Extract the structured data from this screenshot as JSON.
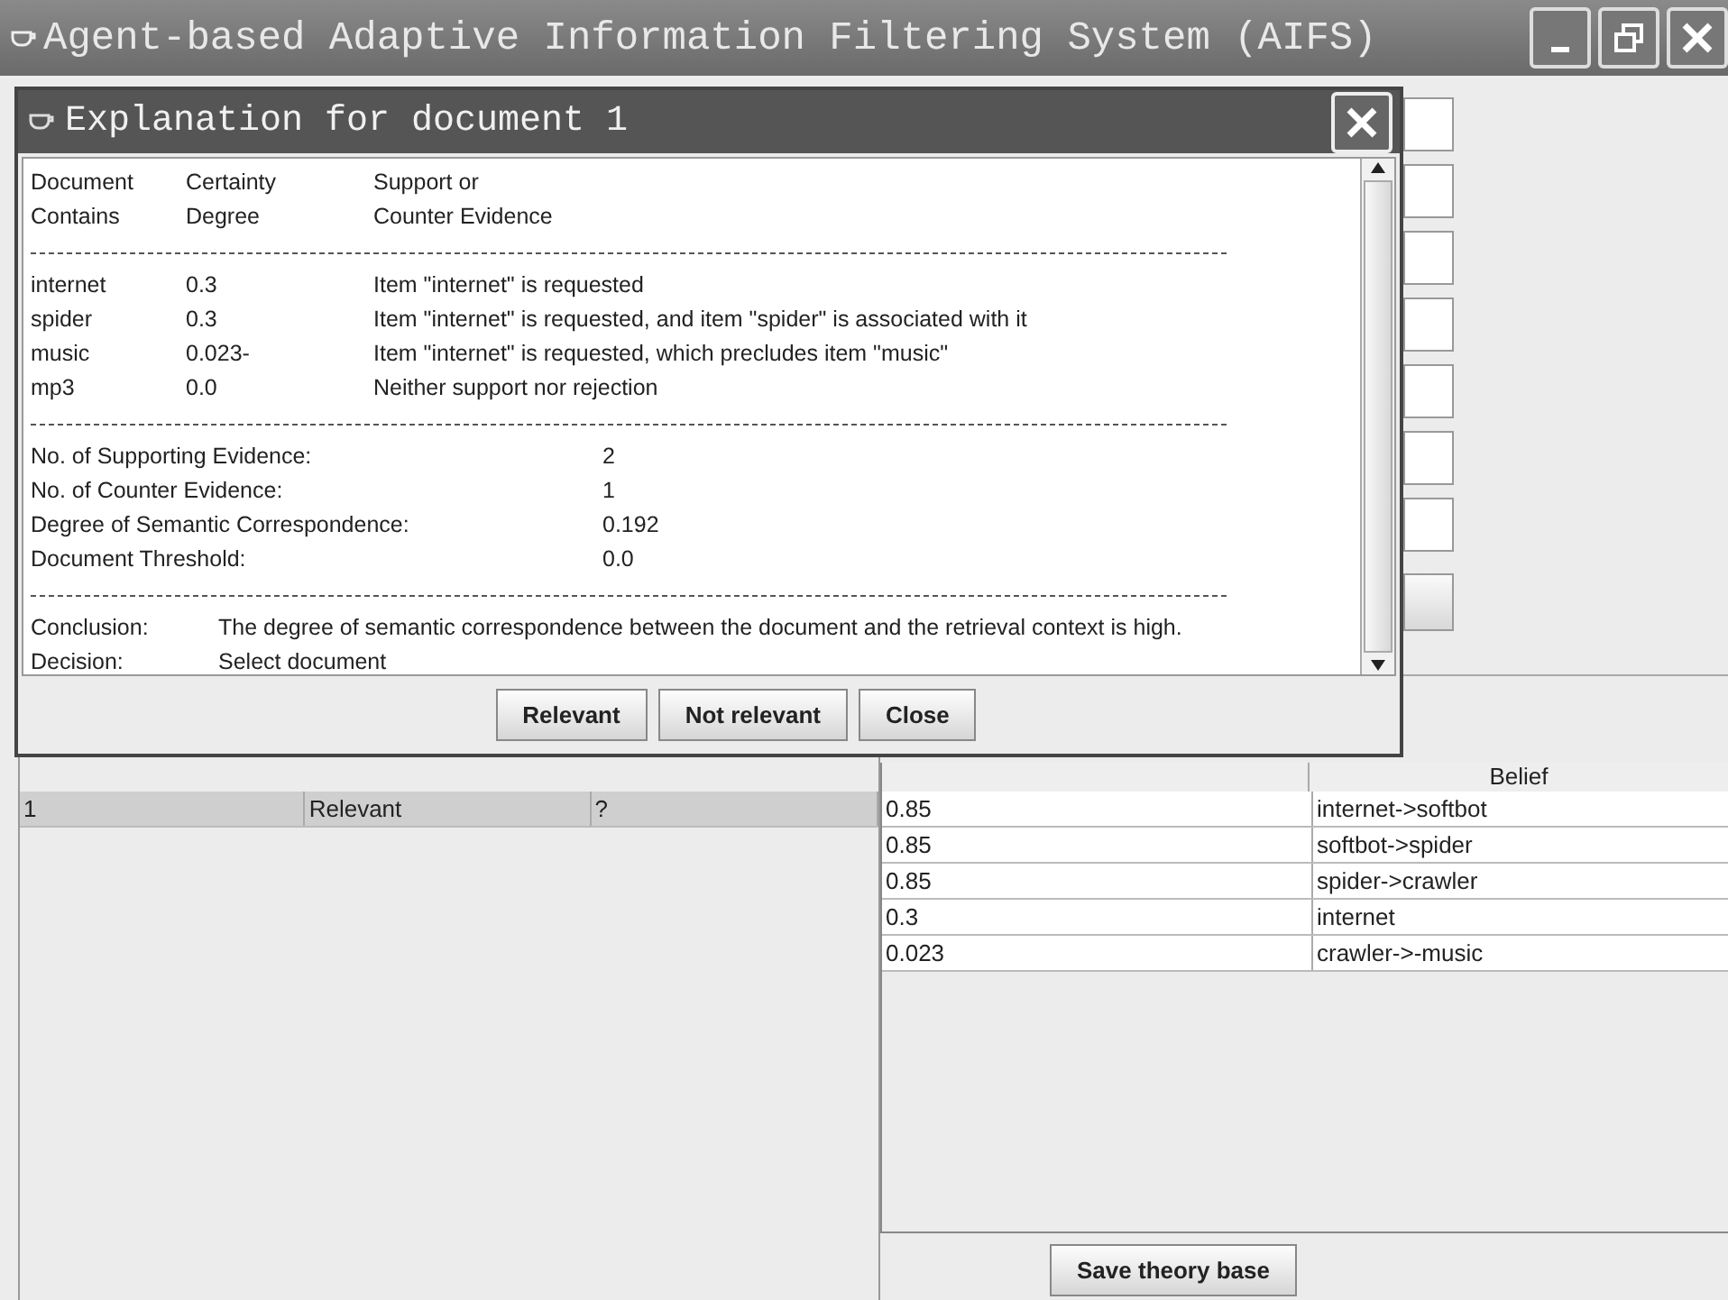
{
  "window": {
    "title": "Agent-based Adaptive Information Filtering System (AIFS)"
  },
  "dialog": {
    "title": "Explanation for document 1",
    "headers": [
      [
        "Document",
        "Contains"
      ],
      [
        "Certainty",
        "Degree"
      ],
      [
        "Support or",
        "Counter Evidence"
      ]
    ],
    "items": [
      {
        "term": "internet",
        "certainty": "0.3",
        "evidence": "Item \"internet\" is requested"
      },
      {
        "term": "spider",
        "certainty": "0.3",
        "evidence": "Item \"internet\" is requested, and item \"spider\" is associated with it"
      },
      {
        "term": "music",
        "certainty": "0.023-",
        "evidence": "Item \"internet\" is requested, which precludes item \"music\""
      },
      {
        "term": "mp3",
        "certainty": "0.0",
        "evidence": "Neither support nor rejection"
      }
    ],
    "stats": [
      {
        "label": "No. of Supporting Evidence:",
        "value": "2"
      },
      {
        "label": "No. of Counter Evidence:",
        "value": "1"
      },
      {
        "label": "Degree of Semantic Correspondence:",
        "value": "0.192"
      },
      {
        "label": "Document Threshold:",
        "value": "0.0"
      }
    ],
    "summary": [
      {
        "label": "Conclusion:",
        "text": "The degree of semantic correspondence between the document and the retrieval context is high."
      },
      {
        "label": "Decision:",
        "text": "Select document"
      }
    ],
    "buttons": [
      "Relevant",
      "Not relevant",
      "Close"
    ]
  },
  "judgement_table": {
    "rows": [
      {
        "id": "1",
        "system": "Relevant",
        "user": "?",
        "selected": true
      }
    ]
  },
  "belief_table": {
    "column_2": "Belief",
    "rows": [
      {
        "degree": "0.85",
        "belief": "internet->softbot"
      },
      {
        "degree": "0.85",
        "belief": "softbot->spider"
      },
      {
        "degree": "0.85",
        "belief": "spider->crawler"
      },
      {
        "degree": "0.3",
        "belief": "internet"
      },
      {
        "degree": "0.023",
        "belief": "crawler->-music"
      }
    ]
  },
  "save_button": "Save theory base"
}
